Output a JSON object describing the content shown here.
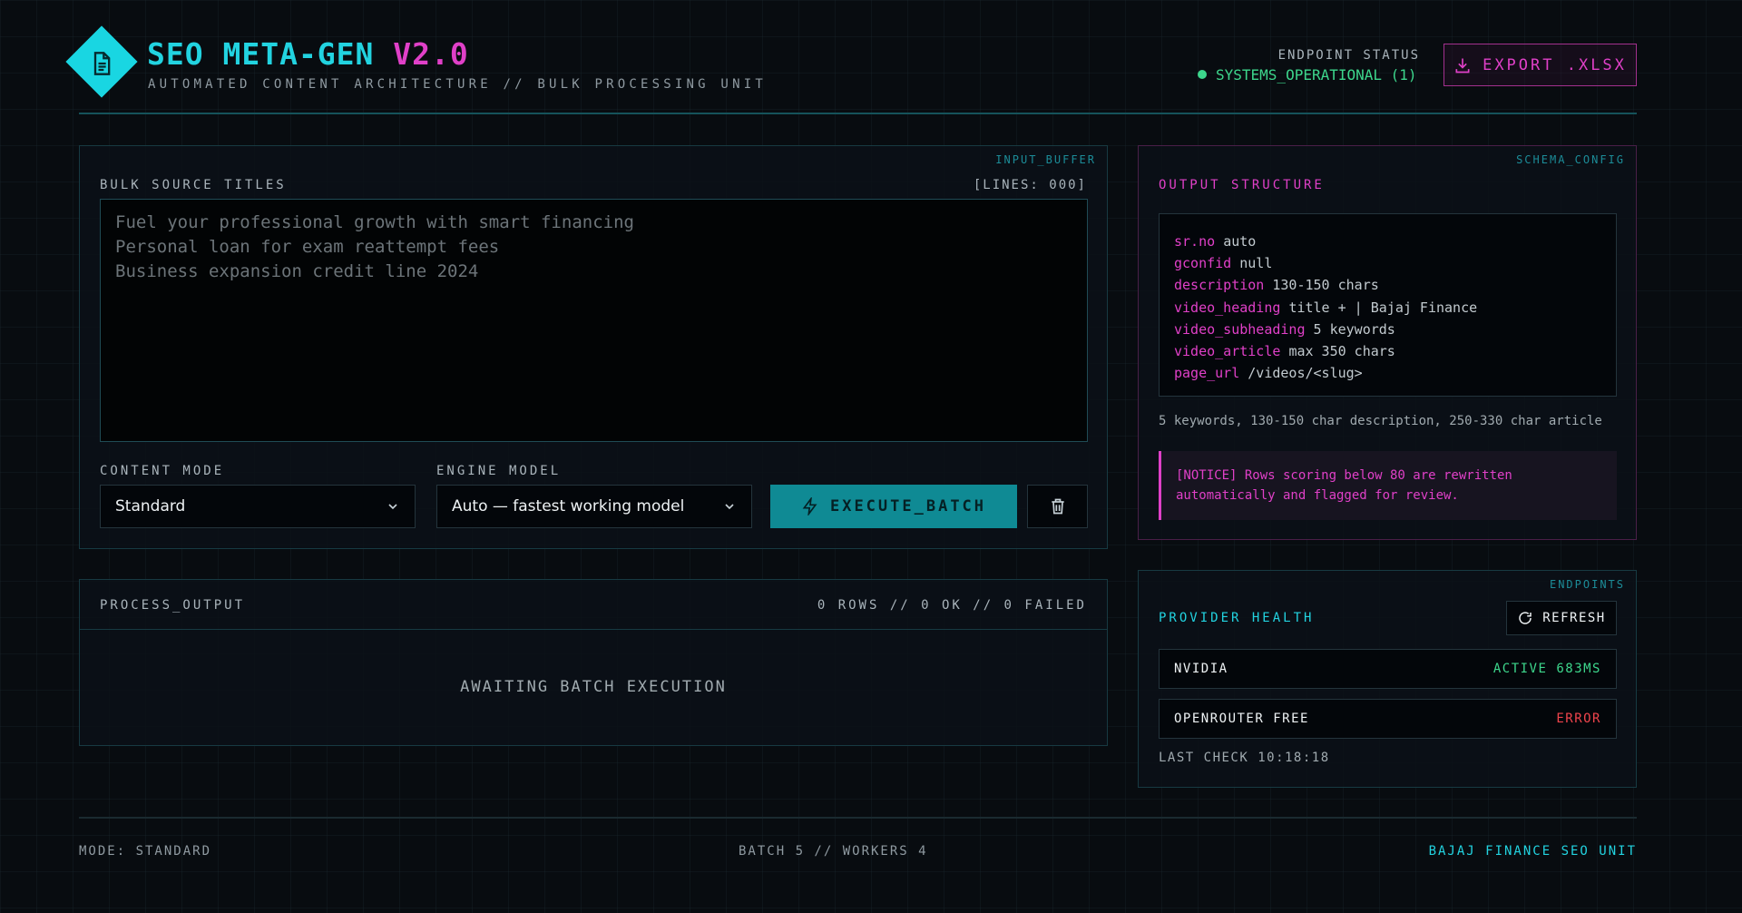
{
  "header": {
    "title_part1": "SEO META-GEN",
    "title_part2": "V2.0",
    "subtitle": "AUTOMATED CONTENT ARCHITECTURE // BULK PROCESSING UNIT",
    "status_label": "ENDPOINT STATUS",
    "status_value": "SYSTEMS_OPERATIONAL (1)",
    "export_label": "EXPORT .XLSX"
  },
  "input_panel": {
    "corner": "INPUT_BUFFER",
    "label": "BULK SOURCE TITLES",
    "lines": "[LINES: 000]",
    "placeholder": "Fuel your professional growth with smart financing\nPersonal loan for exam reattempt fees\nBusiness expansion credit line 2024",
    "content_mode_label": "CONTENT MODE",
    "content_mode_value": "Standard",
    "engine_model_label": "ENGINE MODEL",
    "engine_model_value": "Auto — fastest working model",
    "execute_label": "EXECUTE_BATCH"
  },
  "output_panel": {
    "label": "PROCESS_OUTPUT",
    "stats": "0 ROWS // 0 OK // 0 FAILED",
    "empty_message": "AWAITING BATCH EXECUTION"
  },
  "schema": {
    "corner": "SCHEMA_CONFIG",
    "title": "OUTPUT STRUCTURE",
    "fields": [
      {
        "key": "sr.no",
        "value": "auto"
      },
      {
        "key": "gconfid",
        "value": "null"
      },
      {
        "key": "description",
        "value": "130-150 chars"
      },
      {
        "key": "video_heading",
        "value": "title + | Bajaj Finance"
      },
      {
        "key": "video_subheading",
        "value": "5 keywords"
      },
      {
        "key": "video_article",
        "value": "max 350 chars"
      },
      {
        "key": "page_url",
        "value": "/videos/<slug>"
      }
    ],
    "summary": "5 keywords, 130-150 char description, 250-330 char article",
    "notice": "[NOTICE] Rows scoring below 80 are rewritten automatically and flagged for review."
  },
  "providers": {
    "corner": "ENDPOINTS",
    "title": "PROVIDER HEALTH",
    "refresh_label": "REFRESH",
    "items": [
      {
        "name": "NVIDIA",
        "status": "ACTIVE 683MS",
        "color": "#3dd68c"
      },
      {
        "name": "OPENROUTER FREE",
        "status": "ERROR",
        "color": "#f0444c"
      }
    ],
    "last_check": "LAST CHECK 10:18:18"
  },
  "footer": {
    "mode": "MODE: STANDARD",
    "batch": "BATCH 5 // WORKERS 4",
    "unit": "BAJAJ FINANCE SEO UNIT"
  },
  "colors": {
    "accent": "#22d3e0",
    "secondary": "#e040c8",
    "ok": "#3dd68c",
    "error": "#f0444c"
  },
  "icons": [
    "document-icon",
    "download-icon",
    "chevron-down-icon",
    "bolt-icon",
    "trash-icon",
    "refresh-icon"
  ]
}
